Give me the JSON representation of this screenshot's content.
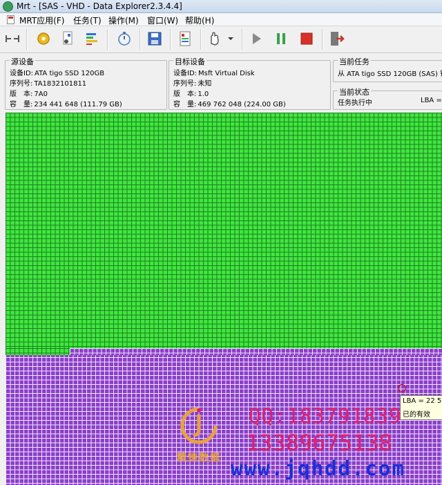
{
  "window": {
    "title": "Mrt - [SAS - VHD - Data Explorer2.3.4.4]"
  },
  "menu": {
    "items": [
      "MRT应用(F)",
      "任务(T)",
      "操作(M)",
      "窗口(W)",
      "帮助(H)"
    ]
  },
  "toolbar": {
    "buttons": [
      "connect-icon",
      "gear-icon",
      "disk-settings-icon",
      "bar-chart-icon",
      "stopwatch-icon",
      "save-icon",
      "report-icon",
      "hand-icon",
      "dropdown-icon",
      "play-icon",
      "pause-icon",
      "stop-icon",
      "exit-icon"
    ],
    "colors": {
      "play": "#8a8a8a",
      "pause": "#3aa14a",
      "stop": "#d9302a",
      "exit": "#c0392b"
    }
  },
  "source": {
    "legend": "源设备",
    "rows": [
      {
        "key": "设备ID:",
        "value": "ATA tigo SSD 120GB"
      },
      {
        "key": "序列号:",
        "value": "TA1832101811"
      },
      {
        "key": "版　本:",
        "value": "7A0"
      },
      {
        "key": "容　量:",
        "value": "234 441 648 (111.79 GB)"
      }
    ]
  },
  "target": {
    "legend": "目标设备",
    "rows": [
      {
        "key": "设备ID:",
        "value": "Msft Virtual Disk"
      },
      {
        "key": "序列号:",
        "value": "未知"
      },
      {
        "key": "版　本:",
        "value": "1.0"
      },
      {
        "key": "容　量:",
        "value": "469 762 048 (224.00 GB)"
      }
    ]
  },
  "current_task": {
    "legend": "当前任务",
    "text": "从 ATA tigo SSD 120GB (SAS) 镜"
  },
  "current_status": {
    "legend": "当前状态",
    "status": "任务执行中",
    "lba_label": "LBA ="
  },
  "block_map": {
    "colors": {
      "done": "#3fe63f",
      "pending": "#8b3fc8",
      "grid_done": "#1f7f1f",
      "grid_pending": "#f2e6ff"
    },
    "done_fraction": 0.63
  },
  "tooltip": {
    "line1": "LBA = 22 5",
    "line2": "已的有效"
  },
  "watermark": {
    "brand": "精铸数据",
    "qq": "QQ:183791839",
    "phone": "13389675138",
    "url": "www.jqhdd.com"
  }
}
